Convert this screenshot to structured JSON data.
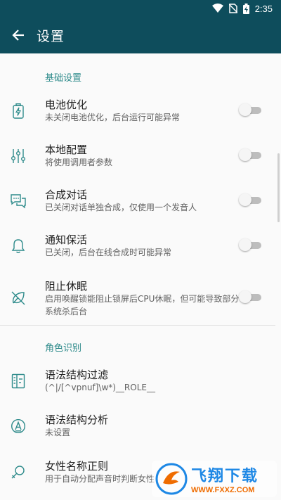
{
  "status_bar": {
    "time": "2:35"
  },
  "app_bar": {
    "title": "设置"
  },
  "sections": [
    {
      "header": "基础设置"
    },
    {
      "header": "角色识别"
    }
  ],
  "basic_items": [
    {
      "icon": "battery-charging-icon",
      "title": "电池优化",
      "summary": "未关闭电池优化，后台运行可能异常",
      "toggle": false
    },
    {
      "icon": "equalizer-sliders-icon",
      "title": "本地配置",
      "summary": "将使用调用者参数",
      "toggle": false
    },
    {
      "icon": "chat-bubbles-icon",
      "title": "合成对话",
      "summary": "已关闭对话单独合成，仅使用一个发音人",
      "toggle": false
    },
    {
      "icon": "bell-icon",
      "title": "通知保活",
      "summary": "已关闭，后台在线合成时可能异常",
      "toggle": false
    },
    {
      "icon": "leaf-off-icon",
      "title": "阻止休眠",
      "summary": "启用唤醒锁能阻止锁屏后CPU休眠，但可能导致部分系统杀后台",
      "toggle": false
    }
  ],
  "role_items": [
    {
      "icon": "document-filter-icon",
      "title": "语法结构过滤",
      "summary": "(^|/[^vpnuf]\\w*)__ROLE__"
    },
    {
      "icon": "circle-a-icon",
      "title": "语法结构分析",
      "summary": "未设置"
    },
    {
      "icon": "female-search-icon",
      "title": "女性名称正则",
      "summary": "用于自动分配声音时判断女性"
    }
  ],
  "watermark": {
    "name": "飞翔下载",
    "url": "WWW.FXXZ.COM"
  },
  "colors": {
    "primary": "#0e4d5c",
    "accent": "#2e8b8b",
    "background": "#fafafa"
  }
}
